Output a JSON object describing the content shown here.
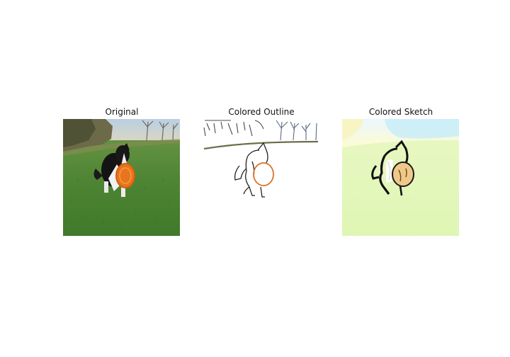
{
  "figure": {
    "panels": [
      {
        "title": "Original"
      },
      {
        "title": "Colored Outline"
      },
      {
        "title": "Colored Sketch"
      }
    ]
  },
  "colors": {
    "grass": "#5a8a3a",
    "sky": "#c9d9e6",
    "frisbee": "#e8741c",
    "dog_dark": "#1a1a1a",
    "sketch_bg": "#f4fbd0"
  }
}
